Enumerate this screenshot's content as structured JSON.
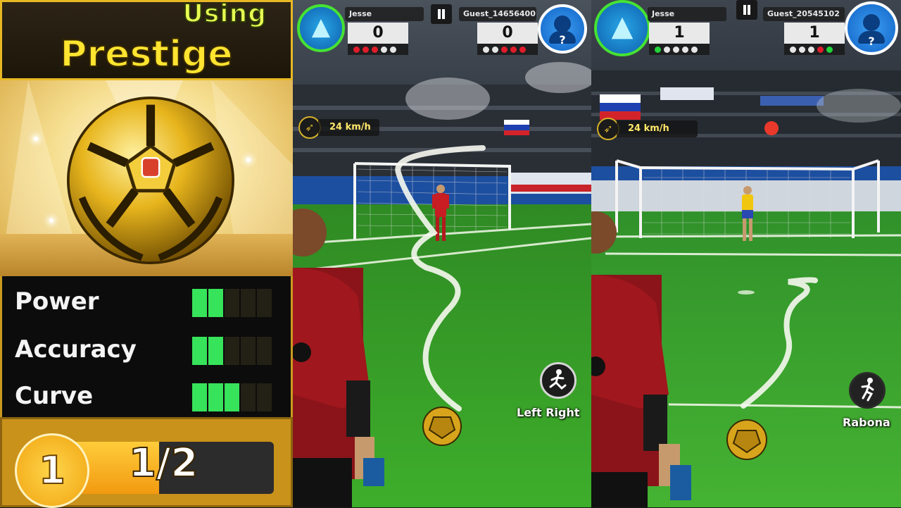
{
  "card": {
    "status": "Using",
    "ball_name": "Prestige",
    "stats": [
      {
        "label": "Power",
        "level": 2,
        "max": 5
      },
      {
        "label": "Accuracy",
        "level": 2,
        "max": 5
      },
      {
        "label": "Curve",
        "level": 3,
        "max": 5
      }
    ],
    "level": "1",
    "progress_text": "1/2",
    "progress_fraction": 0.5
  },
  "match1": {
    "player_left": {
      "name": "Jesse",
      "score": "0",
      "shots": [
        "red",
        "red",
        "red",
        "empty",
        "empty"
      ]
    },
    "player_right": {
      "name": "Guest_14656400",
      "score": "0",
      "shots": [
        "empty",
        "empty",
        "red",
        "red",
        "red"
      ]
    },
    "speed": "24 km/h",
    "kick_label": "Left Right"
  },
  "match2": {
    "player_left": {
      "name": "Jesse",
      "score": "1",
      "shots": [
        "green",
        "empty",
        "empty",
        "empty",
        "empty"
      ]
    },
    "player_right": {
      "name": "Guest_20545102",
      "score": "1",
      "shots": [
        "empty",
        "empty",
        "empty",
        "red",
        "green"
      ]
    },
    "speed": "24 km/h",
    "kick_label": "Rabona"
  },
  "colors": {
    "red": "#e01c2a",
    "green": "#22d33a",
    "empty": "#e6e6e6",
    "accent": "#e7b824"
  }
}
